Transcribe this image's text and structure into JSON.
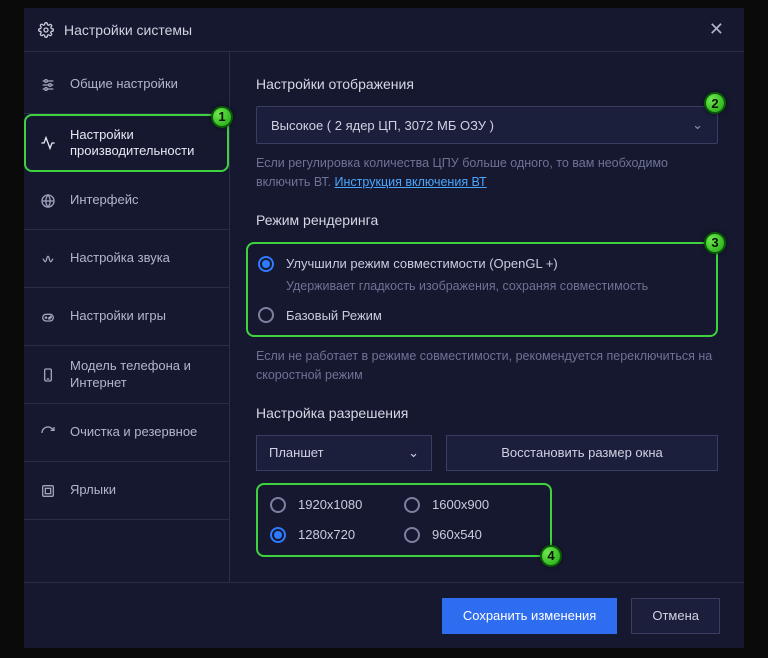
{
  "window": {
    "title": "Настройки системы"
  },
  "sidebar": {
    "items": [
      {
        "label": "Общие настройки"
      },
      {
        "label": "Настройки производительности"
      },
      {
        "label": "Интерфейс"
      },
      {
        "label": "Настройка звука"
      },
      {
        "label": "Настройки игры"
      },
      {
        "label": "Модель телефона и Интернет"
      },
      {
        "label": "Очистка и резервное"
      },
      {
        "label": "Ярлыки"
      }
    ]
  },
  "display": {
    "title": "Настройки отображения",
    "select_value": "Высокое ( 2 ядер ЦП, 3072 МБ ОЗУ )",
    "hint_pre": "Если регулировка количества ЦПУ больше одного, то вам необходимо включить ВТ. ",
    "hint_link": "Инструкция включения ВТ"
  },
  "render": {
    "title": "Режим рендеринга",
    "opt1": "Улучшили режим совместимости (OpenGL +)",
    "opt1_caption": "Удерживает гладкость изображения, сохраняя совместимость",
    "opt2": "Базовый Режим",
    "hint": "Если не работает в режиме совместимости, рекомендуется переключиться на скоростной режим"
  },
  "resolution": {
    "title": "Настройка разрешения",
    "mode": "Планшет",
    "restore": "Восстановить размер окна",
    "opts": [
      "1920x1080",
      "1600x900",
      "1280x720",
      "960x540"
    ]
  },
  "footer": {
    "save": "Сохранить изменения",
    "cancel": "Отмена"
  }
}
